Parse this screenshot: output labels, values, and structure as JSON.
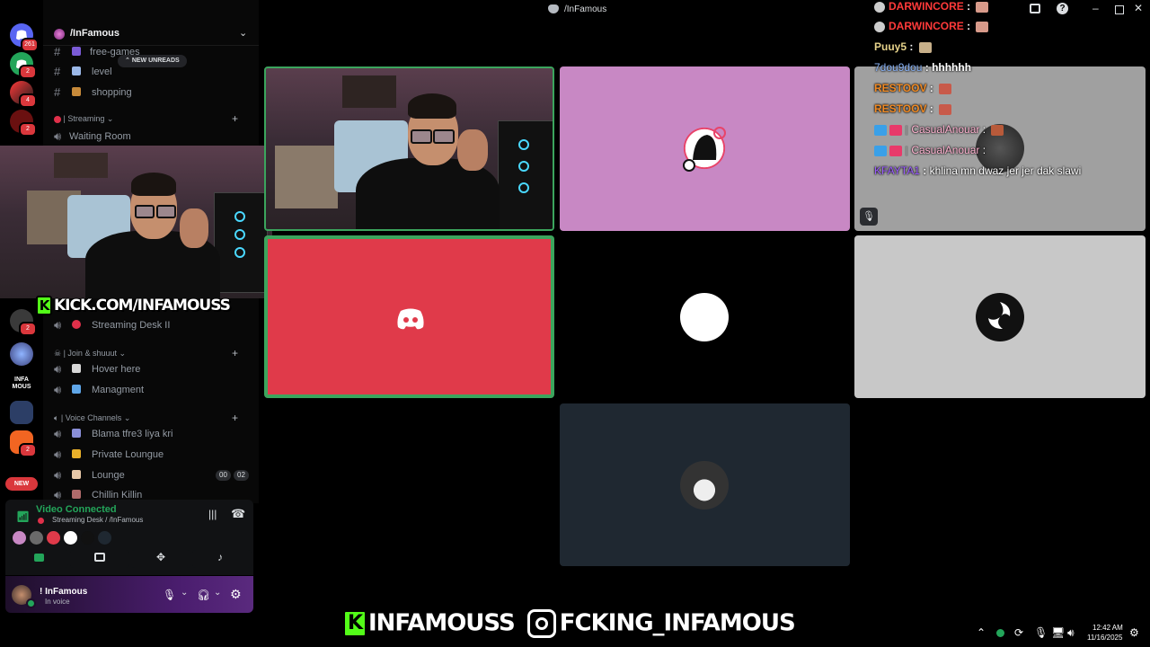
{
  "window": {
    "title": "/InFamous"
  },
  "server_rail": {
    "home_badge": "261",
    "servers": [
      {
        "badge": "2",
        "color": "#23a55a"
      },
      {
        "badge": "4",
        "color": "#5a1e1e"
      },
      {
        "badge": "2",
        "color": "#8a1a1a"
      },
      {
        "badge": "2",
        "color": "#2b2d31"
      },
      {
        "badge": "",
        "color": "#3a3f7a"
      },
      {
        "badge": "",
        "color": "#1a1a1a",
        "label": "INFA MOUS"
      },
      {
        "badge": "",
        "color": "#3b4f7a"
      },
      {
        "badge": "2",
        "color": "#f26522"
      }
    ],
    "new_label": "NEW"
  },
  "sidebar": {
    "server_name": "/InFamous",
    "new_unreads": "NEW UNREADS",
    "channels_top": [
      {
        "label": "free-games"
      },
      {
        "label": "level"
      },
      {
        "label": "shopping"
      }
    ],
    "streaming_category": "| Streaming",
    "waiting_room": "Waiting Room",
    "streaming_desk_2": "Streaming Desk II",
    "join_category": "| Join & shuuut",
    "join_channels": [
      {
        "label": "Hover here"
      },
      {
        "label": "Managment"
      }
    ],
    "voice_category": "| Voice Channels",
    "voice_channels": [
      {
        "label": "Blama tfre3 liya kri"
      },
      {
        "label": "Private Loungue"
      },
      {
        "label": "Lounge",
        "count_a": "00",
        "count_b": "02"
      },
      {
        "label": "Chillin Killin"
      }
    ]
  },
  "voice_panel": {
    "status": "Video Connected",
    "location": "Streaming Desk / /InFamous"
  },
  "user_panel": {
    "username": "! InFamous",
    "status": "In voice"
  },
  "overlay": {
    "kick_url": "KICK.COM/INFAMOUSS",
    "kick_letter": "K",
    "banner_kick": "INFAMOUSS",
    "banner_ig": "FCKING_INFAMOUS"
  },
  "chat": [
    {
      "user": "DARWINCORE",
      "msg": "",
      "color": "#ff3a3a"
    },
    {
      "user": "DARWINCORE",
      "msg": "",
      "color": "#ff3a3a"
    },
    {
      "user": "Puuy5",
      "msg": "",
      "color": "#e6d28a"
    },
    {
      "user": "7dou9dou",
      "msg": "hhhhhh",
      "color": "#8ab4f8"
    },
    {
      "user": "RESTOOV",
      "msg": "",
      "color": "#f08a24"
    },
    {
      "user": "RESTOOV",
      "msg": "",
      "color": "#f08a24"
    },
    {
      "user": "CasualAnouar",
      "msg": "",
      "color": "#ffb3d1"
    },
    {
      "user": "CasualAnouar",
      "msg": "",
      "color": "#ffb3d1"
    },
    {
      "user": "KFAYTA1",
      "msg": "khlina mn dwaz jer jer dak slawi",
      "color": "#9b5cff"
    }
  ],
  "taskbar": {
    "time": "12:42 AM",
    "date": "11/16/2025"
  },
  "colors": {
    "discord_blurple": "#5865f2",
    "tile_pink": "#c888c4",
    "tile_red": "#e03a4a",
    "tile_gray": "#c8c8c8",
    "tile_slate": "#1f2831",
    "connected_green": "#23a55a"
  }
}
